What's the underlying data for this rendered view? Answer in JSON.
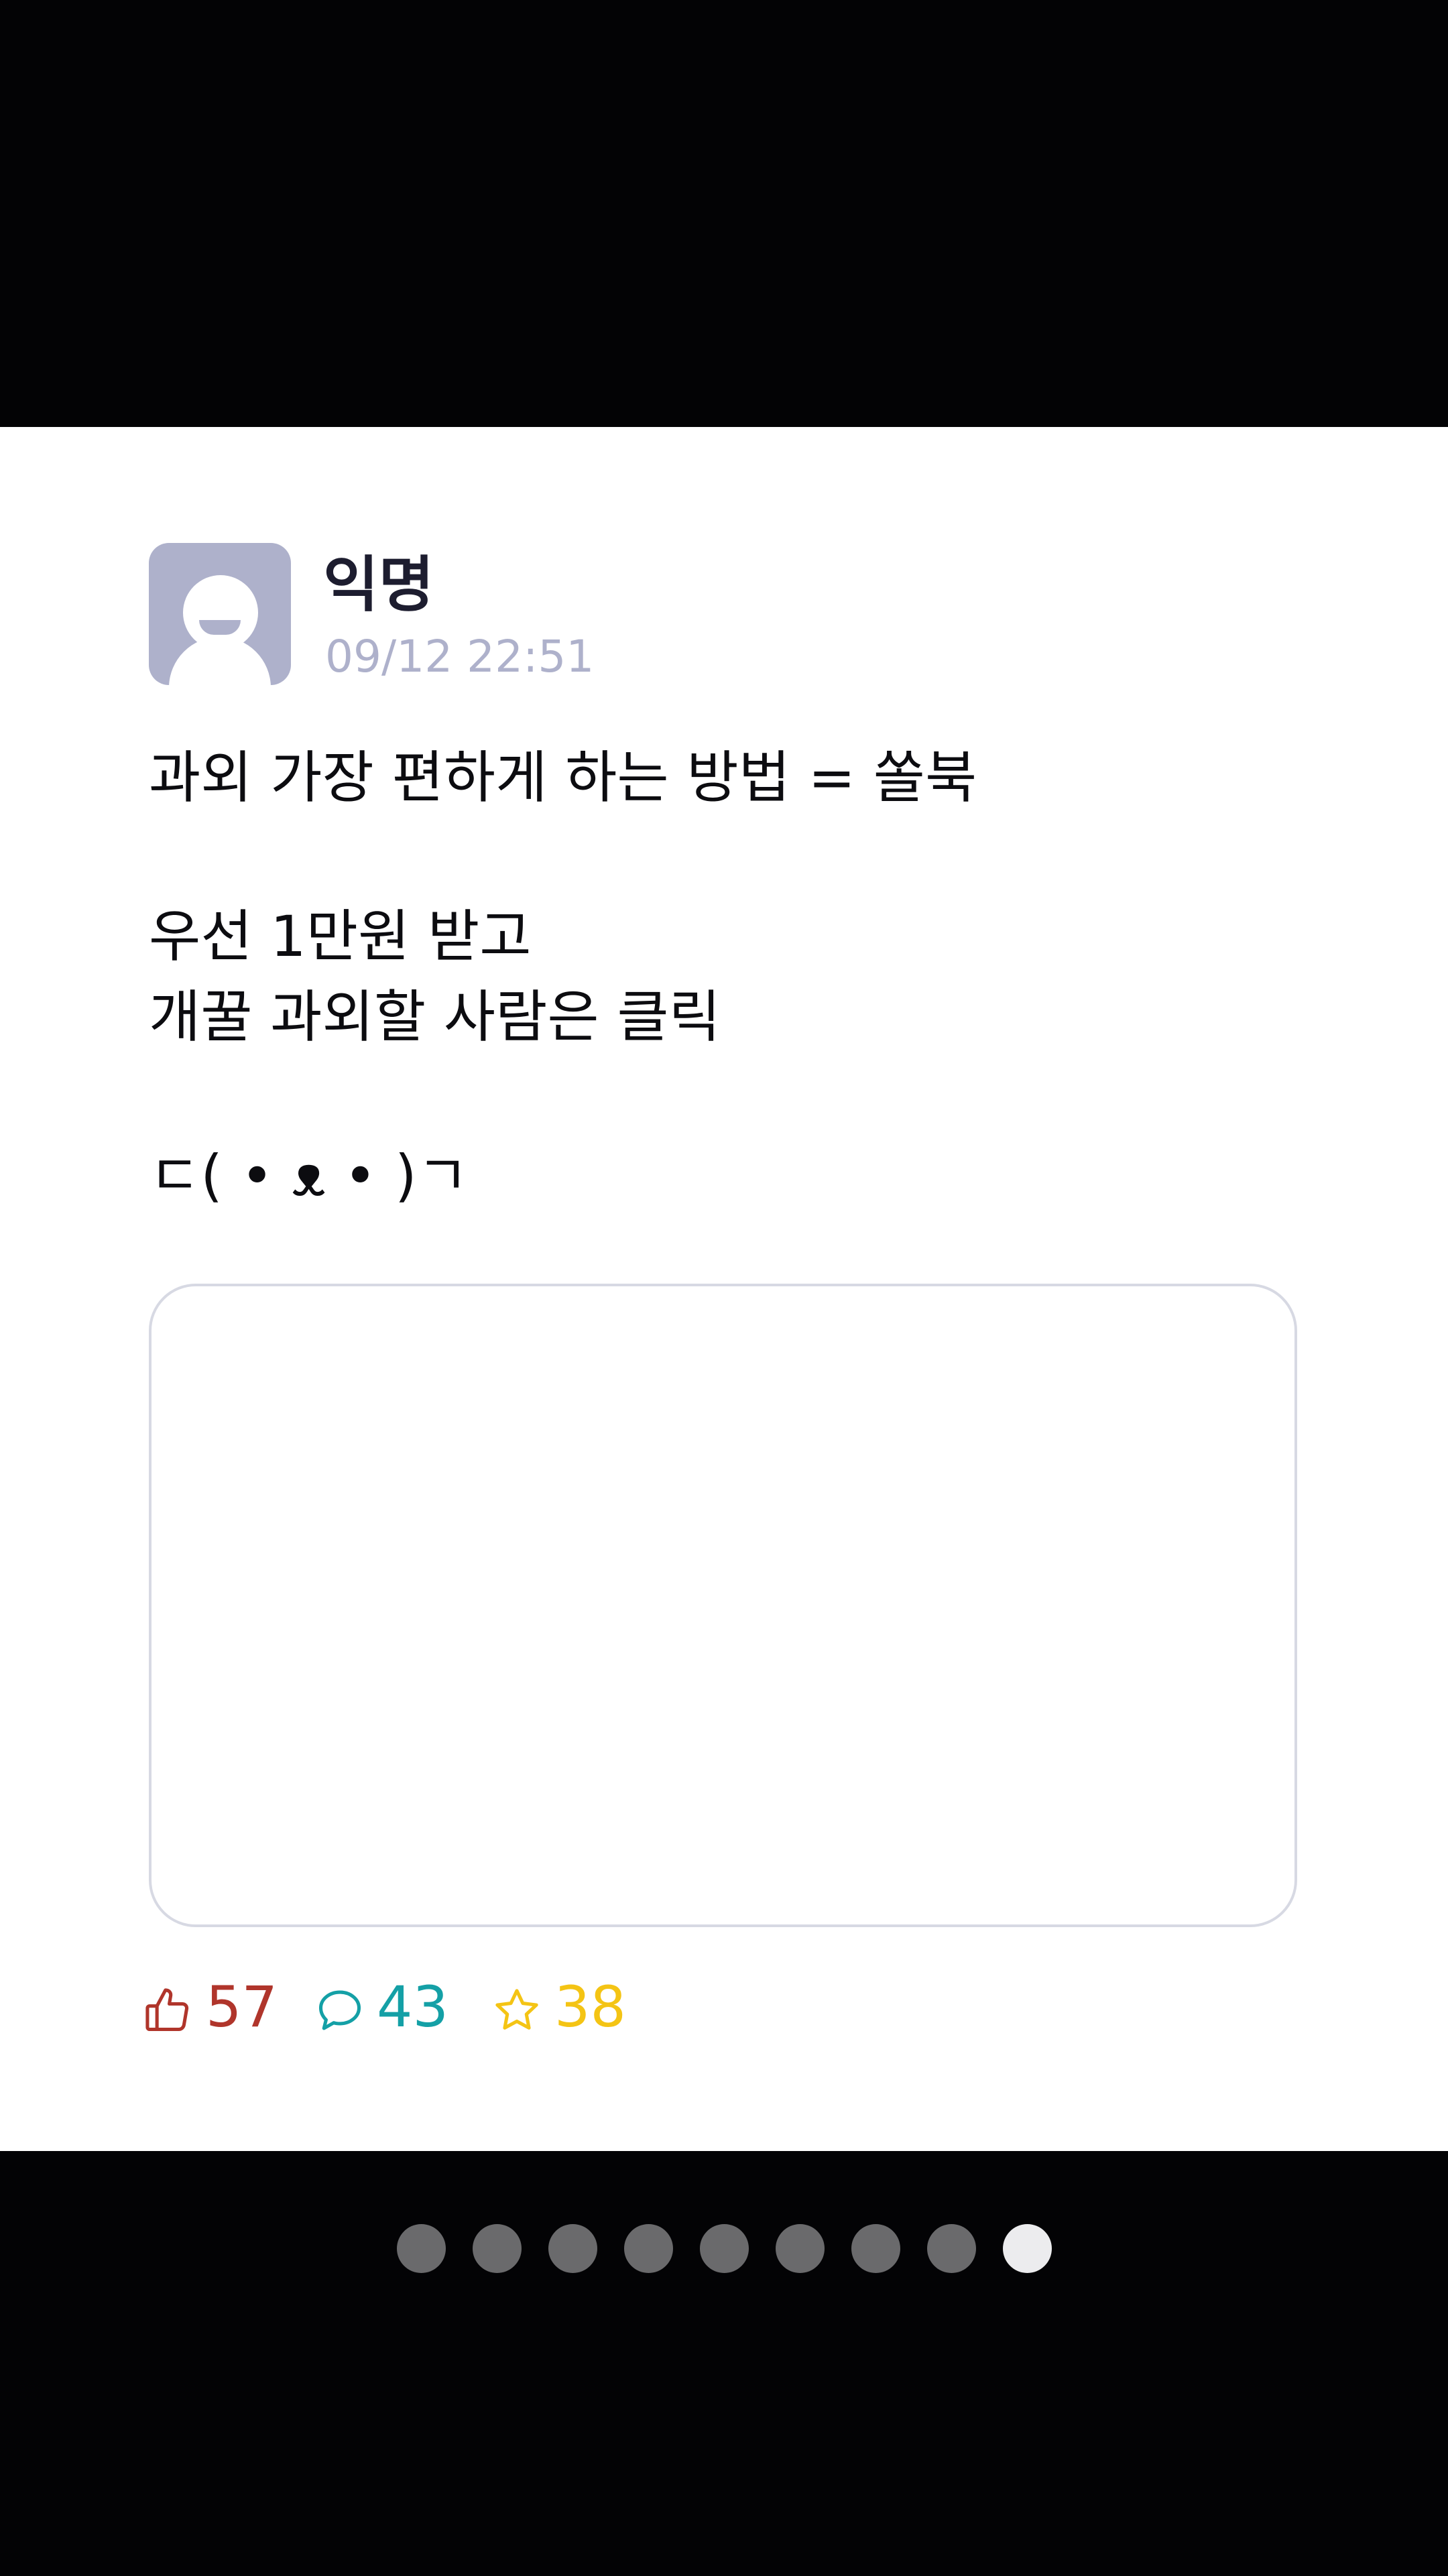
{
  "post": {
    "author": "익명",
    "timestamp": "09/12 22:51",
    "lines": [
      "과외 가장 편하게 하는 방법 = 쏠북",
      "",
      "우선 1만원 받고",
      "개꿀 과외할 사람은 클릭",
      "",
      "ㄷ( • ᴥ • )ㄱ"
    ],
    "stats": {
      "likes": "57",
      "comments": "43",
      "scraps": "38"
    }
  },
  "pagination": {
    "count": 9,
    "active": 9
  },
  "colors": {
    "like": "#b0352b",
    "comment": "#14a0a6",
    "scrap": "#f4c414"
  },
  "icons": [
    "avatar",
    "thumbs-up-icon",
    "comment-bubble-icon",
    "star-icon"
  ]
}
